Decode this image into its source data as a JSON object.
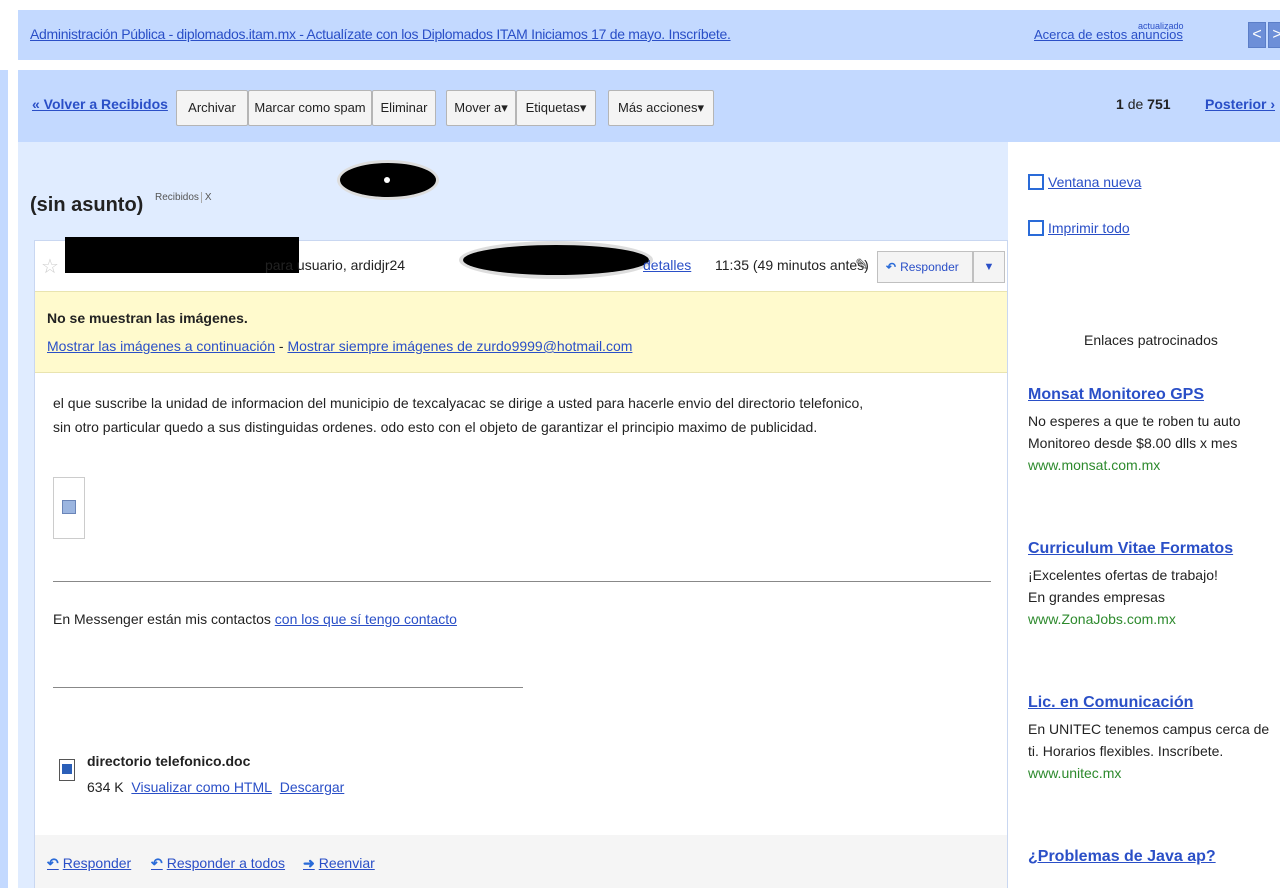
{
  "ad_bar": {
    "text": "Administración Pública - diplomados.itam.mx - Actualízate con los Diplomados ITAM Iniciamos 17 de mayo. Inscríbete.",
    "about_label": "Acerca de estos anuncios",
    "updated_label": "actualizado",
    "prev_label": "<",
    "next_label": ">"
  },
  "toolbar": {
    "back_label": "« Volver a Recibidos",
    "buttons": [
      "Archivar",
      "Marcar como spam",
      "Eliminar",
      "Mover a▾",
      "Etiquetas▾",
      "Más acciones▾"
    ],
    "counter_current": "1",
    "counter_of": "de",
    "counter_total": "751",
    "next_label": "Posterior ›"
  },
  "message": {
    "subject": "(sin asunto)",
    "label": "Recibidos",
    "label_remove": "X",
    "to_text": "para usuario, ardidjr24",
    "details_label": "detalles",
    "time": "11:35 (49 minutos antes)",
    "reply_label": "Responder",
    "more_label": "▼",
    "warning": {
      "title": "No se muestran las imágenes.",
      "show_below": "Mostrar las imágenes a continuación",
      "separator": " - ",
      "always_show": "Mostrar siempre imágenes de zurdo9999@hotmail.com"
    },
    "body_line1": "el que suscribe la unidad de informacion del municipio de texcalyacac se dirige a usted para hacerle envio del directorio telefonico,",
    "body_line2": "sin otro particular quedo a sus distinguidas ordenes. odo esto con el objeto de garantizar el principio maximo de publicidad.",
    "messenger_text": "En Messenger están mis contactos",
    "messenger_link": "con los que sí tengo contacto",
    "attachment": {
      "name": "directorio telefonico.doc",
      "size": "634 K",
      "view_html": "Visualizar como HTML",
      "download": "Descargar"
    },
    "footer": {
      "reply": "Responder",
      "reply_all": "Responder a todos",
      "forward": "Reenviar"
    }
  },
  "sidebar": {
    "new_window": "Ventana nueva",
    "print_all": "Imprimir todo",
    "sponsored_title": "Enlaces patrocinados",
    "ads": [
      {
        "title": "Monsat Monitoreo GPS",
        "line1": "No esperes a que te roben tu auto",
        "line2": "Monitoreo desde $8.00 dlls x mes",
        "url": "www.monsat.com.mx"
      },
      {
        "title": "Curriculum Vitae Formatos",
        "line1": "¡Excelentes ofertas de trabajo!",
        "line2": "En grandes empresas",
        "url": "www.ZonaJobs.com.mx"
      },
      {
        "title": "Lic. en Comunicación",
        "line1": "En UNITEC tenemos campus cerca de",
        "line2": "ti. Horarios flexibles. Inscríbete.",
        "url": "www.unitec.mx"
      },
      {
        "title": "¿Problemas de Java ap?",
        "line1": "",
        "line2": "",
        "url": ""
      }
    ]
  }
}
